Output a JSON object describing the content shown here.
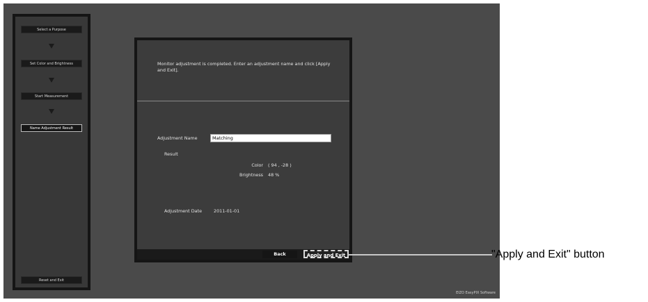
{
  "sidebar": {
    "steps": [
      {
        "label": "Select a Purpose"
      },
      {
        "label": "Set Color and Brightness"
      },
      {
        "label": "Start Measurement"
      },
      {
        "label": "Name Adjustment Result"
      }
    ],
    "reset_label": "Reset and Exit"
  },
  "panel": {
    "instruction": "Monitor adjustment is completed. Enter an adjustment name and click [Apply and Exit].",
    "adjustment_name_label": "Adjustment Name",
    "adjustment_name_value": "Matching",
    "result_label": "Result",
    "color_label": "Color",
    "color_value": "( 94 , -28 )",
    "brightness_label": "Brightness",
    "brightness_value": "48 %",
    "date_label": "Adjustment Date",
    "date_value": "2011-01-01",
    "back_label": "Back",
    "apply_label": "Apply and Exit"
  },
  "footer_brand": "EIZO EasyPIX Software",
  "callout_text": "\"Apply and Exit\" button"
}
